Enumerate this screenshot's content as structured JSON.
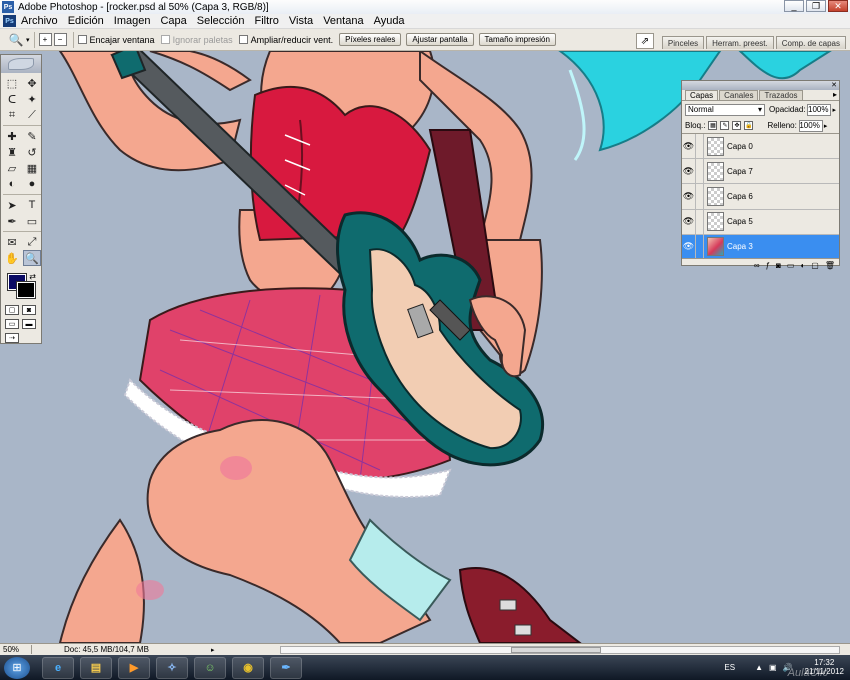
{
  "window": {
    "title": "Adobe Photoshop - [rocker.psd al 50% (Capa 3, RGB/8)]",
    "app_icon": "Ps",
    "minimize_icon": "minimize-icon",
    "maximize_icon": "maximize-icon",
    "close_icon": "close-icon"
  },
  "menu": {
    "items": [
      "Archivo",
      "Edición",
      "Imagen",
      "Capa",
      "Selección",
      "Filtro",
      "Vista",
      "Ventana",
      "Ayuda"
    ]
  },
  "options_bar": {
    "tool_icon": "zoom-icon",
    "checkboxes": [
      {
        "label": "Encajar ventana",
        "checked": false,
        "disabled": false
      },
      {
        "label": "Ignorar paletas",
        "checked": false,
        "disabled": true
      },
      {
        "label": "Ampliar/reducir vent.",
        "checked": false,
        "disabled": false
      }
    ],
    "buttons": [
      "Píxeles reales",
      "Ajustar pantalla",
      "Tamaño impresión"
    ],
    "palette_wells": [
      "Pinceles",
      "Herram. preest.",
      "Comp. de capas"
    ]
  },
  "toolbox": {
    "tools": [
      "marquee-icon",
      "move-icon",
      "lasso-icon",
      "magic-wand-icon",
      "crop-icon",
      "slice-icon",
      "healing-brush-icon",
      "brush-icon",
      "clone-stamp-icon",
      "history-brush-icon",
      "eraser-icon",
      "gradient-icon",
      "blur-icon",
      "dodge-icon",
      "path-selection-icon",
      "type-icon",
      "pen-icon",
      "shape-icon",
      "notes-icon",
      "eyedropper-icon",
      "hand-icon",
      "zoom-icon"
    ],
    "active_tool": "zoom-icon",
    "foreground_color": "#0a0a64",
    "background_color": "#000000"
  },
  "layers_panel": {
    "tabs": [
      "Capas",
      "Canales",
      "Trazados"
    ],
    "active_tab": "Capas",
    "blend_mode": "Normal",
    "opacity_label": "Opacidad:",
    "opacity": "100%",
    "lock_label": "Bloq.:",
    "fill_label": "Relleno:",
    "fill": "100%",
    "layers": [
      {
        "name": "Capa 0",
        "visible": true,
        "selected": false
      },
      {
        "name": "Capa 7",
        "visible": true,
        "selected": false
      },
      {
        "name": "Capa 6",
        "visible": true,
        "selected": false
      },
      {
        "name": "Capa 5",
        "visible": true,
        "selected": false
      },
      {
        "name": "Capa 3",
        "visible": true,
        "selected": true
      }
    ]
  },
  "status_bar": {
    "zoom": "50%",
    "doc": "Doc: 45,5 MB/104,7 MB"
  },
  "taskbar": {
    "apps": [
      "internet-explorer-icon",
      "file-explorer-icon",
      "media-player-icon",
      "photoshop-icon",
      "messenger-icon",
      "chrome-icon",
      "feather-icon"
    ],
    "language": "ES",
    "time": "17:32",
    "date": "21/11/2012"
  },
  "watermark": "AulaClic",
  "colors": {
    "canvas_bg": "#a9b6c8",
    "selected_layer": "#3a8ef0",
    "skin": "#f4a78f",
    "corset": "#d8193f",
    "skirt": "#e0426a",
    "guitar": "#0f6b6e",
    "hair": "#2ad2e0"
  }
}
